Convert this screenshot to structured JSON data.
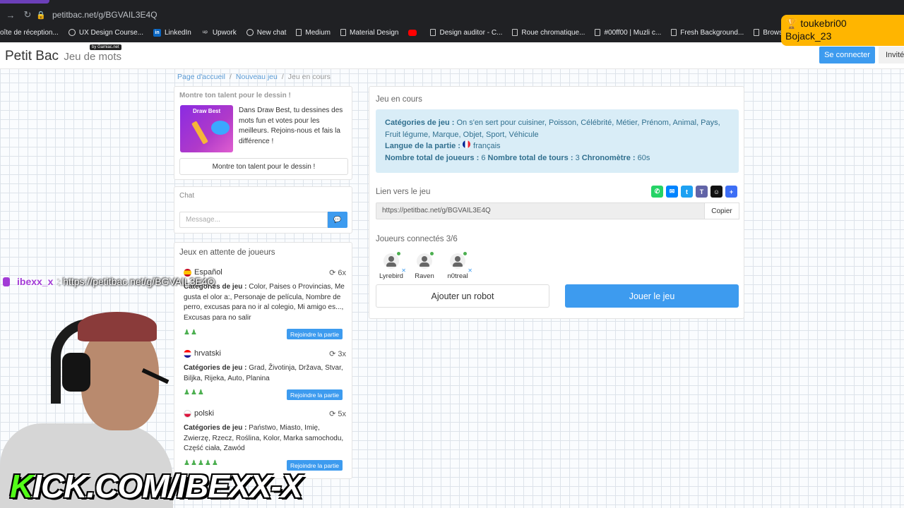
{
  "browser": {
    "url": "petitbac.net/g/BGVAIL3E4Q",
    "bookmarks": [
      {
        "label": "oîte de réception...",
        "icon": "doc-icon"
      },
      {
        "label": "UX Design Course...",
        "icon": "circle-icon"
      },
      {
        "label": "LinkedIn",
        "icon": "linkedin-icon"
      },
      {
        "label": "Upwork",
        "icon": "upwork-icon"
      },
      {
        "label": "New chat",
        "icon": "openai-icon"
      },
      {
        "label": "Medium",
        "icon": "doc-icon"
      },
      {
        "label": "Material Design",
        "icon": "doc-icon"
      },
      {
        "label": "",
        "icon": "youtube-icon"
      },
      {
        "label": "Design auditor - C...",
        "icon": "doc-icon"
      },
      {
        "label": "Roue chromatique...",
        "icon": "doc-icon"
      },
      {
        "label": "#00ff00 | Muzli c...",
        "icon": "doc-icon"
      },
      {
        "label": "Fresh Background...",
        "icon": "doc-icon"
      },
      {
        "label": "Browse Fon",
        "icon": "doc-icon"
      }
    ]
  },
  "header": {
    "brand": "Petit Bac",
    "brand_sub": "Jeu de mots",
    "gamiac": "by Gamiac.net",
    "login": "Se connecter",
    "guest": "Invité"
  },
  "breadcrumb": {
    "home": "Page d'accueil",
    "new_game": "Nouveau jeu",
    "current": "Jeu en cours",
    "sep": "/"
  },
  "promo": {
    "label": "Montre ton talent pour le dessin !",
    "image_title": "Draw Best",
    "text": "Dans Draw Best, tu dessines des mots fun et votes pour les meilleurs. Rejoins-nous et fais la différence !",
    "button": "Montre ton talent pour le dessin !"
  },
  "chat": {
    "label": "Chat",
    "placeholder": "Message..."
  },
  "waiting": {
    "title": "Jeux en attente de joueurs",
    "cats_label": "Catégories de jeu :",
    "join_label": "Rejoindre la partie",
    "games": [
      {
        "lang": "Español",
        "rounds": "6x",
        "cats": "Color, Paises o Provincias, Me gusta el olor a:, Personaje de película, Nombre de perro, excusas para no ir al colegio, Mi amigo es..., Excusas para no salir",
        "players": "♟♟"
      },
      {
        "lang": "hrvatski",
        "rounds": "3x",
        "cats": "Grad, Životinja, Država, Stvar, Biljka, Rijeka, Auto, Planina",
        "players": "♟♟♟"
      },
      {
        "lang": "polski",
        "rounds": "5x",
        "cats": "Państwo, Miasto, Imię, Zwierzę, Rzecz, Roślina, Kolor, Marka samochodu, Część ciała, Zawód",
        "players": "♟♟♟♟♟"
      }
    ]
  },
  "current": {
    "title": "Jeu en cours",
    "cats_label": "Catégories de jeu :",
    "cats": "On s'en sert pour cuisiner, Poisson, Célébrité, Métier, Prénom, Animal, Pays, Fruit légume, Marque, Objet, Sport, Véhicule",
    "lang_label": "Langue de la partie :",
    "lang": "français",
    "players_total_label": "Nombre total de joueurs :",
    "players_total": "6",
    "rounds_label": "Nombre total de tours :",
    "rounds": "3",
    "timer_label": "Chronomètre :",
    "timer": "60s",
    "link_label": "Lien vers le jeu",
    "link": "https://petitbac.net/g/BGVAIL3E4Q",
    "copy": "Copier",
    "connected_label": "Joueurs connectés 3/6",
    "players": [
      "Lyrebird",
      "Raven",
      "n0treal"
    ],
    "add_robot": "Ajouter un robot",
    "play": "Jouer le jeu",
    "share_colors": [
      "#25d366",
      "#0084ff",
      "#1da1f2",
      "#6264a7",
      "#111111",
      "#3d6ef5"
    ]
  },
  "overlays": {
    "top_user_1": "toukebri00",
    "top_user_2": "Bojack_23",
    "chat_user": "ibexx_x",
    "chat_msg": ": https://petitbac.net/g/BGVAIL3E4Q",
    "kick_k": "K",
    "kick_rest": "ICK.COM/IBEXX-X"
  },
  "colors": {
    "primary": "#3d9bef",
    "info_bg": "#d9edf7",
    "info_text": "#31708f",
    "overlay": "#ffb500",
    "kick": "#53fc18"
  }
}
